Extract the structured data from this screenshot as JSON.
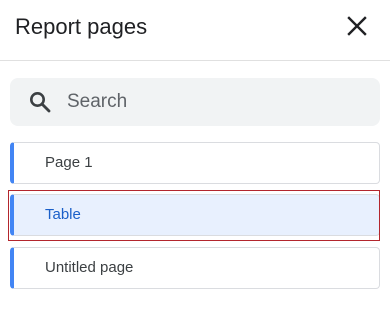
{
  "panel": {
    "title": "Report pages",
    "close_icon": "close-icon"
  },
  "search": {
    "placeholder": "Search",
    "value": "",
    "icon": "search-icon"
  },
  "pages": [
    {
      "label": "Page 1",
      "selected": false
    },
    {
      "label": "Table",
      "selected": true
    },
    {
      "label": "Untitled page",
      "selected": false
    }
  ],
  "colors": {
    "accent": "#4285f4",
    "selected_background": "#e8f0fe",
    "selection_outline": "#b3262d"
  }
}
